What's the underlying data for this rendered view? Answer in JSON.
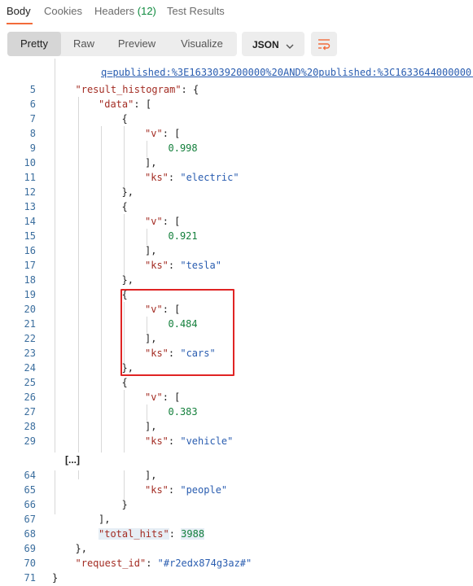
{
  "tabs": [
    {
      "label": "Body",
      "active": true
    },
    {
      "label": "Cookies"
    },
    {
      "label": "Headers",
      "count": "(12)"
    },
    {
      "label": "Test Results"
    }
  ],
  "view_modes": [
    "Pretty",
    "Raw",
    "Preview",
    "Visualize"
  ],
  "active_view": "Pretty",
  "format": "JSON",
  "url_line": "q=published:%3E1633039200000%20AND%20published:%3C1633644000000\"",
  "collapsed_marker": "[...]",
  "code_lines": [
    {
      "n": "5",
      "text": "\"result_histogram\": {"
    },
    {
      "n": "6",
      "text": "\"data\": ["
    },
    {
      "n": "7",
      "text": "{"
    },
    {
      "n": "8",
      "text": "\"v\": ["
    },
    {
      "n": "9",
      "text": "0.998"
    },
    {
      "n": "10",
      "text": "],"
    },
    {
      "n": "11",
      "text": "\"ks\": \"electric\""
    },
    {
      "n": "12",
      "text": "},"
    },
    {
      "n": "13",
      "text": "{"
    },
    {
      "n": "14",
      "text": "\"v\": ["
    },
    {
      "n": "15",
      "text": "0.921"
    },
    {
      "n": "16",
      "text": "],"
    },
    {
      "n": "17",
      "text": "\"ks\": \"tesla\""
    },
    {
      "n": "18",
      "text": "},"
    },
    {
      "n": "19",
      "text": "{"
    },
    {
      "n": "20",
      "text": "\"v\": ["
    },
    {
      "n": "21",
      "text": "0.484"
    },
    {
      "n": "22",
      "text": "],"
    },
    {
      "n": "23",
      "text": "\"ks\": \"cars\""
    },
    {
      "n": "24",
      "text": "},"
    },
    {
      "n": "25",
      "text": "{"
    },
    {
      "n": "26",
      "text": "\"v\": ["
    },
    {
      "n": "27",
      "text": "0.383"
    },
    {
      "n": "28",
      "text": "],"
    },
    {
      "n": "29",
      "text": "\"ks\": \"vehicle\""
    },
    {
      "n": "64",
      "text": "],"
    },
    {
      "n": "65",
      "text": "\"ks\": \"people\""
    },
    {
      "n": "66",
      "text": "}"
    },
    {
      "n": "67",
      "text": "],"
    },
    {
      "n": "68",
      "text": "\"total_hits\": 3988"
    },
    {
      "n": "69",
      "text": "},"
    },
    {
      "n": "70",
      "text": "\"request_id\": \"#r2edx874g3az#\""
    },
    {
      "n": "71",
      "text": "}"
    }
  ],
  "colors": {
    "accent": "#f26b3a",
    "key": "#a32c23",
    "string": "#2a5db0",
    "number": "#15803d",
    "highlight_box": "#e02424"
  }
}
